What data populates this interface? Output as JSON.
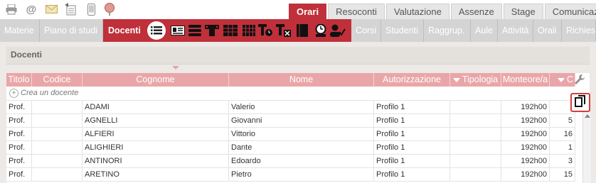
{
  "toolbar": {
    "icons": [
      "printer-icon",
      "at-icon",
      "envelope-icon",
      "export-icon",
      "mobile-icon",
      "location-icon"
    ]
  },
  "main_tabs": [
    {
      "label": "Orari",
      "active": true
    },
    {
      "label": "Resoconti",
      "active": false
    },
    {
      "label": "Valutazione",
      "active": false
    },
    {
      "label": "Assenze",
      "active": false
    },
    {
      "label": "Stage",
      "active": false
    },
    {
      "label": "Comunicazioni",
      "active": false
    }
  ],
  "sub_tabs_left": [
    "Materie",
    "Piano di studi"
  ],
  "sub_tab_active": "Docenti",
  "sub_tabs_right": [
    "Corsi",
    "Studenti",
    "Raggrup.",
    "Aule",
    "Attività",
    "Orali",
    "Richies"
  ],
  "view_icons": [
    "list-view-icon",
    "card-view-icon",
    "schedule-view-icon",
    "occupancy-view-icon",
    "grid-view-icon",
    "timetable-view-icon",
    "clock-view-icon",
    "remove-view-icon",
    "book-view-icon",
    "person-clock-icon",
    "person-check-icon"
  ],
  "panel": {
    "title": "Docenti"
  },
  "grid": {
    "columns": [
      "Titolo",
      "Codice",
      "Cognome",
      "Nome",
      "Autorizzazione",
      "Tipologia",
      "Monteore/a",
      "C"
    ],
    "new_row_label": "Crea un docente",
    "rows": [
      {
        "titolo": "Prof.",
        "codice": "",
        "cognome": "ADAMI",
        "nome": "Valerio",
        "autorizzazione": "Profilo 1",
        "tipologia": "",
        "monteore": "192h00",
        "c": ""
      },
      {
        "titolo": "Prof.",
        "codice": "",
        "cognome": "AGNELLI",
        "nome": "Giovanni",
        "autorizzazione": "Profilo 1",
        "tipologia": "",
        "monteore": "192h00",
        "c": "5"
      },
      {
        "titolo": "Prof.",
        "codice": "",
        "cognome": "ALFIERI",
        "nome": "Vittorio",
        "autorizzazione": "Profilo 1",
        "tipologia": "",
        "monteore": "192h00",
        "c": "16"
      },
      {
        "titolo": "Prof.",
        "codice": "",
        "cognome": "ALIGHIERI",
        "nome": "Dante",
        "autorizzazione": "Profilo 1",
        "tipologia": "",
        "monteore": "192h00",
        "c": "1"
      },
      {
        "titolo": "Prof.",
        "codice": "",
        "cognome": "ANTINORI",
        "nome": "Edoardo",
        "autorizzazione": "Profilo 1",
        "tipologia": "",
        "monteore": "192h00",
        "c": "3"
      },
      {
        "titolo": "Prof.",
        "codice": "",
        "cognome": "ARETINO",
        "nome": "Pietro",
        "autorizzazione": "Profilo 1",
        "tipologia": "",
        "monteore": "192h00",
        "c": "15"
      }
    ]
  },
  "colors": {
    "accent": "#c0303a",
    "header": "#e9a6a8",
    "highlight": "#d83b3b"
  }
}
